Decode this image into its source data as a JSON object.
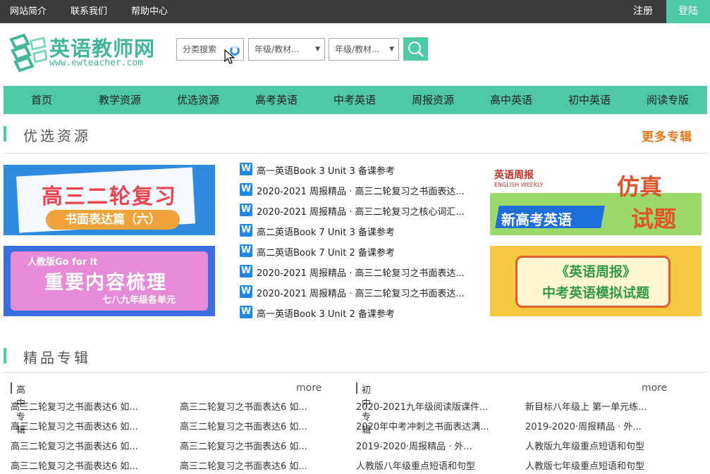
{
  "topbar": {
    "links": [
      "网站简介",
      "联系我们",
      "帮助中心"
    ],
    "register": "注册",
    "login": "登陆"
  },
  "logo": {
    "cn": "英语教师网",
    "en": "www.ewteacher.com"
  },
  "search": {
    "category": "分类搜索",
    "grade1": "年级/教材...",
    "grade2": "年级/教材..."
  },
  "nav": [
    "首页",
    "教学资源",
    "优选资源",
    "高考英语",
    "中考英语",
    "周报资源",
    "高中英语",
    "初中英语",
    "阅读专版"
  ],
  "featured": {
    "title": "优选资源",
    "more": "更多专辑",
    "banners": [
      {
        "line1": "高三二轮复习",
        "line2": "书面表达篇（六）"
      },
      {
        "line0": "人教版Go for it",
        "line1": "重要内容梳理",
        "line2": "七八九年级各单元"
      },
      {
        "brand": "英语周报",
        "brand_sub": "ENGLISH WEEKLY",
        "line1": "新高考英语",
        "line2": "仿真",
        "line3": "试题"
      },
      {
        "line1": "《英语周报》",
        "line2": "中考英语模拟试题"
      }
    ],
    "articles": [
      "高一英语Book 3 Unit 3 备课参考",
      "2020-2021 周报精品 · 高三二轮复习之书面表达...",
      "2020-2021 周报精品 · 高三二轮复习之核心词汇...",
      "高二英语Book 7 Unit 3 备课参考",
      "高二英语Book 7 Unit 2 备课参考",
      "2020-2021 周报精品 · 高三二轮复习之书面表达...",
      "2020-2021 周报精品 · 高三二轮复习之书面表达...",
      "高一英语Book 3 Unit 2 备课参考"
    ],
    "w_icon": "W"
  },
  "albums": {
    "title": "精品专辑",
    "high": {
      "label": "高中专辑",
      "more": "more",
      "col1": [
        "高三二轮复习之书面表达6 如...",
        "高三二轮复习之书面表达6 如...",
        "高三二轮复习之书面表达6 如...",
        "高三二轮复习之书面表达6 如..."
      ],
      "col2": [
        "高三二轮复习之书面表达6 如...",
        "高三二轮复习之书面表达6 如...",
        "高三二轮复习之书面表达6 如...",
        "高三二轮复习之书面表达6 如..."
      ]
    },
    "middle": {
      "label": "初中专辑",
      "more": "more",
      "col1": [
        "2020-2021九年级阅读版课件...",
        "2020年中考冲刺之书面表达满...",
        "2019-2020·周报精品 · 外...",
        "人教版八年级重点短语和句型"
      ],
      "col2": [
        "新目标八年级上 第一单元练...",
        "2019-2020·周报精品 · 外...",
        "人教版九年级重点短语和句型",
        "人教版七年级重点短语和句型"
      ]
    }
  },
  "colors": {
    "accent": "#4ec9a6",
    "topbar": "#3b3b3b",
    "more": "#e07a1c",
    "word_icon": "#1e88e5"
  },
  "icons": [
    "search-icon",
    "loading-spinner-icon",
    "mouse-cursor-icon",
    "word-doc-icon",
    "dropdown-arrow-icon"
  ]
}
